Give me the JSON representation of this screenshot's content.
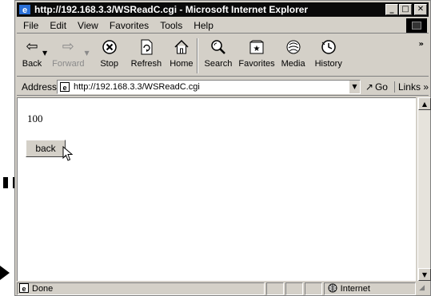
{
  "window": {
    "title": "http://192.168.3.3/WSReadC.cgi - Microsoft Internet Explorer",
    "buttons": {
      "minimize": "_",
      "maximize": "□",
      "close": "✕"
    }
  },
  "menu": {
    "items": [
      "File",
      "Edit",
      "View",
      "Favorites",
      "Tools",
      "Help"
    ]
  },
  "toolbar": {
    "back": {
      "label": "Back",
      "icon": "back-arrow-icon"
    },
    "forward": {
      "label": "Forward",
      "icon": "forward-arrow-icon"
    },
    "stop": {
      "label": "Stop",
      "icon": "stop-icon"
    },
    "refresh": {
      "label": "Refresh",
      "icon": "refresh-icon"
    },
    "home": {
      "label": "Home",
      "icon": "home-icon"
    },
    "search": {
      "label": "Search",
      "icon": "search-icon"
    },
    "favorites": {
      "label": "Favorites",
      "icon": "favorites-icon"
    },
    "media": {
      "label": "Media",
      "icon": "media-icon"
    },
    "history": {
      "label": "History",
      "icon": "history-icon"
    },
    "more": "»"
  },
  "address": {
    "label": "Address",
    "url": "http://192.168.3.3/WSReadC.cgi",
    "go_label": "Go",
    "links_label": "Links »"
  },
  "content": {
    "value": "100",
    "back_button": "back"
  },
  "status": {
    "text": "Done",
    "zone": "Internet"
  },
  "colors": {
    "titlebar": "#0a0a0a",
    "chrome": "#d4d0c8",
    "page_bg": "#ffffff"
  }
}
